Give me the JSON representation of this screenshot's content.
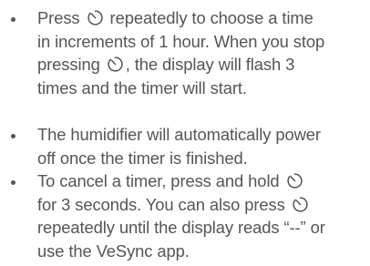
{
  "items": [
    {
      "lines": [
        [
          "Press ",
          "{timer}",
          " repeatedly to choose a time"
        ],
        [
          "in increments of 1 hour. When you stop"
        ],
        [
          "pressing ",
          "{timer}",
          ", the display will flash 3"
        ],
        [
          "times and the timer will start."
        ]
      ]
    },
    {
      "lines": [
        [
          "The humidifier will automatically power"
        ],
        [
          "off once the timer is finished."
        ]
      ]
    },
    {
      "lines": [
        [
          "To cancel a timer, press and hold ",
          "{timer}"
        ],
        [
          "for 3 seconds. You can also press ",
          "{timer}"
        ],
        [
          "repeatedly until the display reads “--” or"
        ],
        [
          "use the VeSync app."
        ]
      ]
    }
  ],
  "icons": {
    "timer": "timer-icon"
  },
  "colors": {
    "text": "#555559",
    "background": "#ffffff"
  }
}
